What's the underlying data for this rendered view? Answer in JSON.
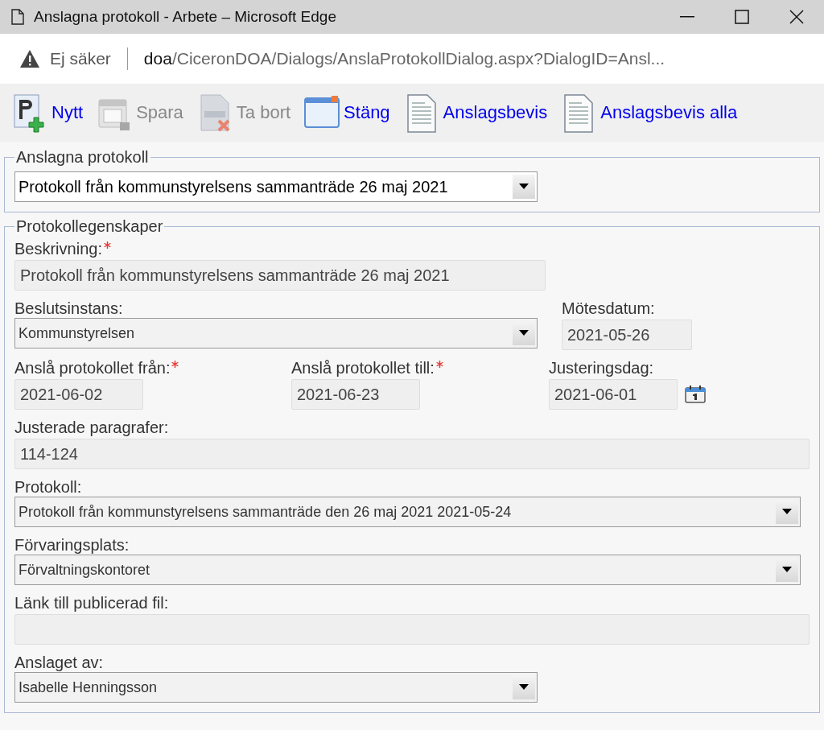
{
  "window": {
    "title": "Anslagna protokoll - Arbete – Microsoft Edge"
  },
  "address_bar": {
    "security": "Ej säker",
    "host": "doa",
    "path": "/CiceronDOA/Dialogs/AnslaProtokollDialog.aspx?DialogID=Ansl..."
  },
  "toolbar": [
    {
      "kind": "new",
      "label": "Nytt",
      "disabled": false
    },
    {
      "kind": "save",
      "label": "Spara",
      "disabled": true
    },
    {
      "kind": "delete",
      "label": "Ta bort",
      "disabled": true
    },
    {
      "kind": "close",
      "label": "Stäng",
      "disabled": false
    },
    {
      "kind": "document",
      "label": "Anslagsbevis",
      "disabled": false
    },
    {
      "kind": "document",
      "label": "Anslagsbevis alla",
      "disabled": false
    }
  ],
  "protocol_group": {
    "legend": "Anslagna protokoll",
    "select": {
      "value": "Protokoll från kommunstyrelsens sammanträde 26 maj 2021",
      "disabled": false
    }
  },
  "properties_group": {
    "legend": "Protokollegenskaper",
    "rows": [
      {
        "fields": [
          {
            "kind": "text",
            "label": "Beskrivning:",
            "required": true,
            "value": "Protokoll från kommunstyrelsens sammanträde 26 maj 2021",
            "disabled": true
          }
        ]
      },
      {
        "fields": [
          {
            "kind": "select",
            "label": "Beslutsinstans:",
            "required": false,
            "value": "Kommunstyrelsen",
            "disabled": true
          },
          {
            "kind": "text",
            "label": "Mötesdatum:",
            "required": false,
            "value": "2021-05-26",
            "disabled": true
          }
        ]
      },
      {
        "fields": [
          {
            "kind": "text",
            "label": "Anslå protokollet från:",
            "required": true,
            "value": "2021-06-02",
            "disabled": true
          },
          {
            "kind": "text",
            "label": "Anslå protokollet till:",
            "required": true,
            "value": "2021-06-23",
            "disabled": true
          },
          {
            "kind": "date",
            "label": "Justeringsdag:",
            "required": false,
            "value": "2021-06-01",
            "disabled": true
          }
        ]
      },
      {
        "fields": [
          {
            "kind": "text",
            "label": "Justerade paragrafer:",
            "required": false,
            "value": "114-124",
            "disabled": true
          }
        ]
      },
      {
        "fields": [
          {
            "kind": "select",
            "label": "Protokoll:",
            "required": false,
            "value": "Protokoll från kommunstyrelsens sammanträde den 26 maj 2021 2021-05-24",
            "disabled": true
          }
        ]
      },
      {
        "fields": [
          {
            "kind": "select",
            "label": "Förvaringsplats:",
            "required": false,
            "value": "Förvaltningskontoret",
            "disabled": true
          }
        ]
      },
      {
        "fields": [
          {
            "kind": "text",
            "label": "Länk till publicerad fil:",
            "required": false,
            "disabled": true
          }
        ]
      },
      {
        "fields": [
          {
            "kind": "select",
            "label": "Anslaget av:",
            "required": false,
            "value": "Isabelle Henningsson",
            "disabled": true
          }
        ]
      }
    ]
  }
}
